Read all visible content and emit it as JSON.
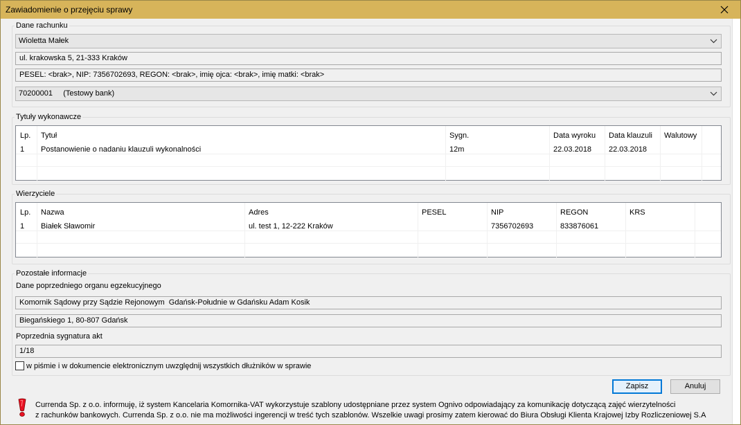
{
  "window": {
    "title": "Zawiadomienie o przejęciu sprawy",
    "close_glyph": "✕"
  },
  "account": {
    "label": "Dane rachunku",
    "debtor": "Wioletta Małek",
    "address": "ul. krakowska 5, 21-333 Kraków",
    "identifiers": "PESEL: <brak>, NIP: 7356702693, REGON: <brak>, imię ojca: <brak>, imię matki: <brak>",
    "bank": "70200001     (Testowy bank)"
  },
  "titles": {
    "label": "Tytuły wykonawcze",
    "columns": [
      "Lp.",
      "Tytuł",
      "Sygn.",
      "Data wyroku",
      "Data klauzuli",
      "Walutowy"
    ],
    "rows": [
      [
        "1",
        "Postanowienie o nadaniu klauzuli wykonalności",
        "12m",
        "22.03.2018",
        "22.03.2018",
        ""
      ]
    ]
  },
  "creditors": {
    "label": "Wierzyciele",
    "columns": [
      "Lp.",
      "Nazwa",
      "Adres",
      "PESEL",
      "NIP",
      "REGON",
      "KRS"
    ],
    "rows": [
      [
        "1",
        "Białek Sławomir",
        "ul. test 1, 12-222 Kraków",
        "",
        "7356702693",
        "833876061",
        ""
      ]
    ]
  },
  "other": {
    "label": "Pozostałe informacje",
    "prev_organ_label": "Dane poprzedniego organu egzekucyjnego",
    "prev_organ_name": "Komornik Sądowy przy Sądzie Rejonowym  Gdańsk-Południe w Gdańsku Adam Kosik",
    "prev_organ_address": "Biegańskiego 1, 80-807 Gdańsk",
    "prev_signature_label": "Poprzednia sygnatura akt",
    "prev_signature": "1/18",
    "all_debtors_checkbox_label": "w piśmie i w dokumencie elektronicznym uwzględnij wszystkich dłużników w sprawie",
    "all_debtors_checked": false
  },
  "buttons": {
    "save": "Zapisz",
    "cancel": "Anuluj"
  },
  "info": {
    "line1": "Currenda Sp. z o.o. informuję, iż system Kancelaria Komornika-VAT wykorzystuje szablony udostępniane przez system Ognivo odpowiadający za komunikację dotyczącą zajęć wierzytelności",
    "line2": "z rachunków bankowych. Currenda Sp. z o.o. nie ma możliwości ingerencji w treść tych szablonów. Wszelkie uwagi prosimy zatem kierować do Biura Obsługi Klienta Krajowej Izby Rozliczeniowej S.A"
  },
  "colors": {
    "titlebar": "#d7b45a",
    "warning_icon": "#e81123",
    "accent": "#0078d7"
  }
}
